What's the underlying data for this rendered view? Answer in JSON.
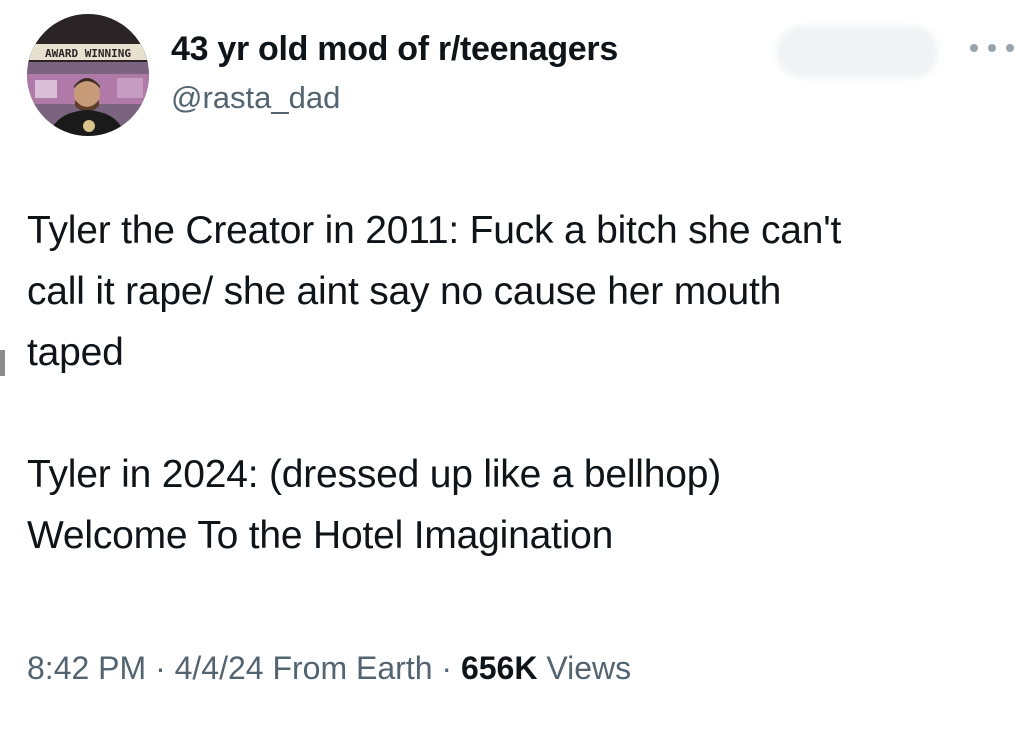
{
  "author": {
    "display_name": "43 yr old mod of r/teenagers",
    "handle": "@rasta_dad",
    "avatar_banner_text": "AWARD WINNING"
  },
  "tweet": {
    "text": "Tyler the Creator in 2011: Fuck a bitch she can't\ncall it rape/ she aint say no cause her mouth\ntaped\n\nTyler in 2024: (dressed up like a bellhop)\nWelcome To the Hotel Imagination"
  },
  "meta": {
    "time": "8:42 PM",
    "separator": " · ",
    "date": "4/4/24",
    "source": "From Earth",
    "views_count": "656K",
    "views_label": " Views"
  },
  "icons": {
    "more": "more-horizontal-icon"
  },
  "colors": {
    "text_primary": "#0f1419",
    "text_secondary": "#536471",
    "background": "#ffffff"
  }
}
